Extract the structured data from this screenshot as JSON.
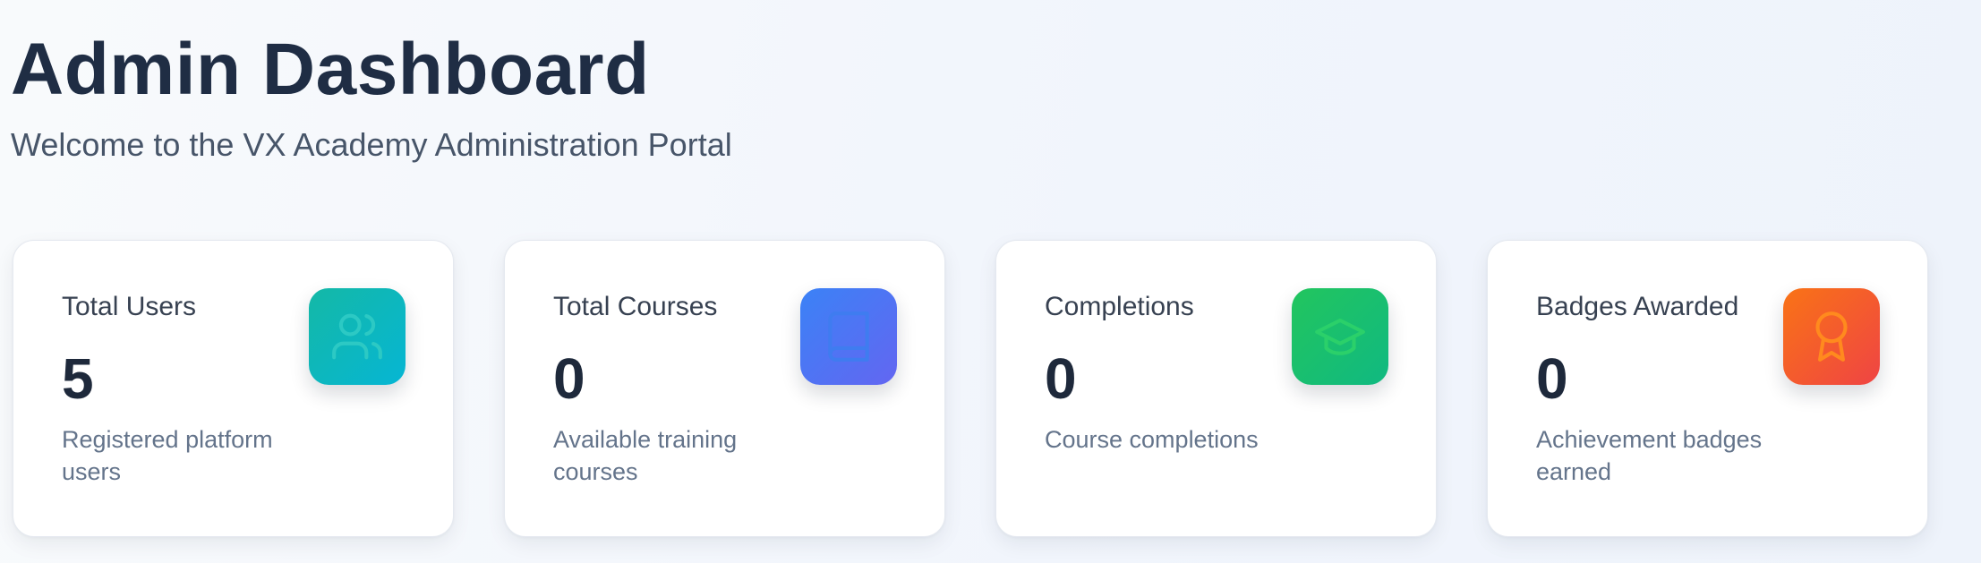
{
  "header": {
    "title": "Admin Dashboard",
    "subtitle": "Welcome to the VX Academy Administration Portal"
  },
  "cards": [
    {
      "label": "Total Users",
      "value": "5",
      "description": "Registered platform users",
      "icon": "users-icon",
      "accent": "#14b8a6"
    },
    {
      "label": "Total Courses",
      "value": "0",
      "description": "Available training courses",
      "icon": "book-icon",
      "accent": "#3b82f6"
    },
    {
      "label": "Completions",
      "value": "0",
      "description": "Course completions",
      "icon": "graduation-cap-icon",
      "accent": "#22c55e"
    },
    {
      "label": "Badges Awarded",
      "value": "0",
      "description": "Achievement badges earned",
      "icon": "award-icon",
      "accent": "#f97316"
    }
  ]
}
